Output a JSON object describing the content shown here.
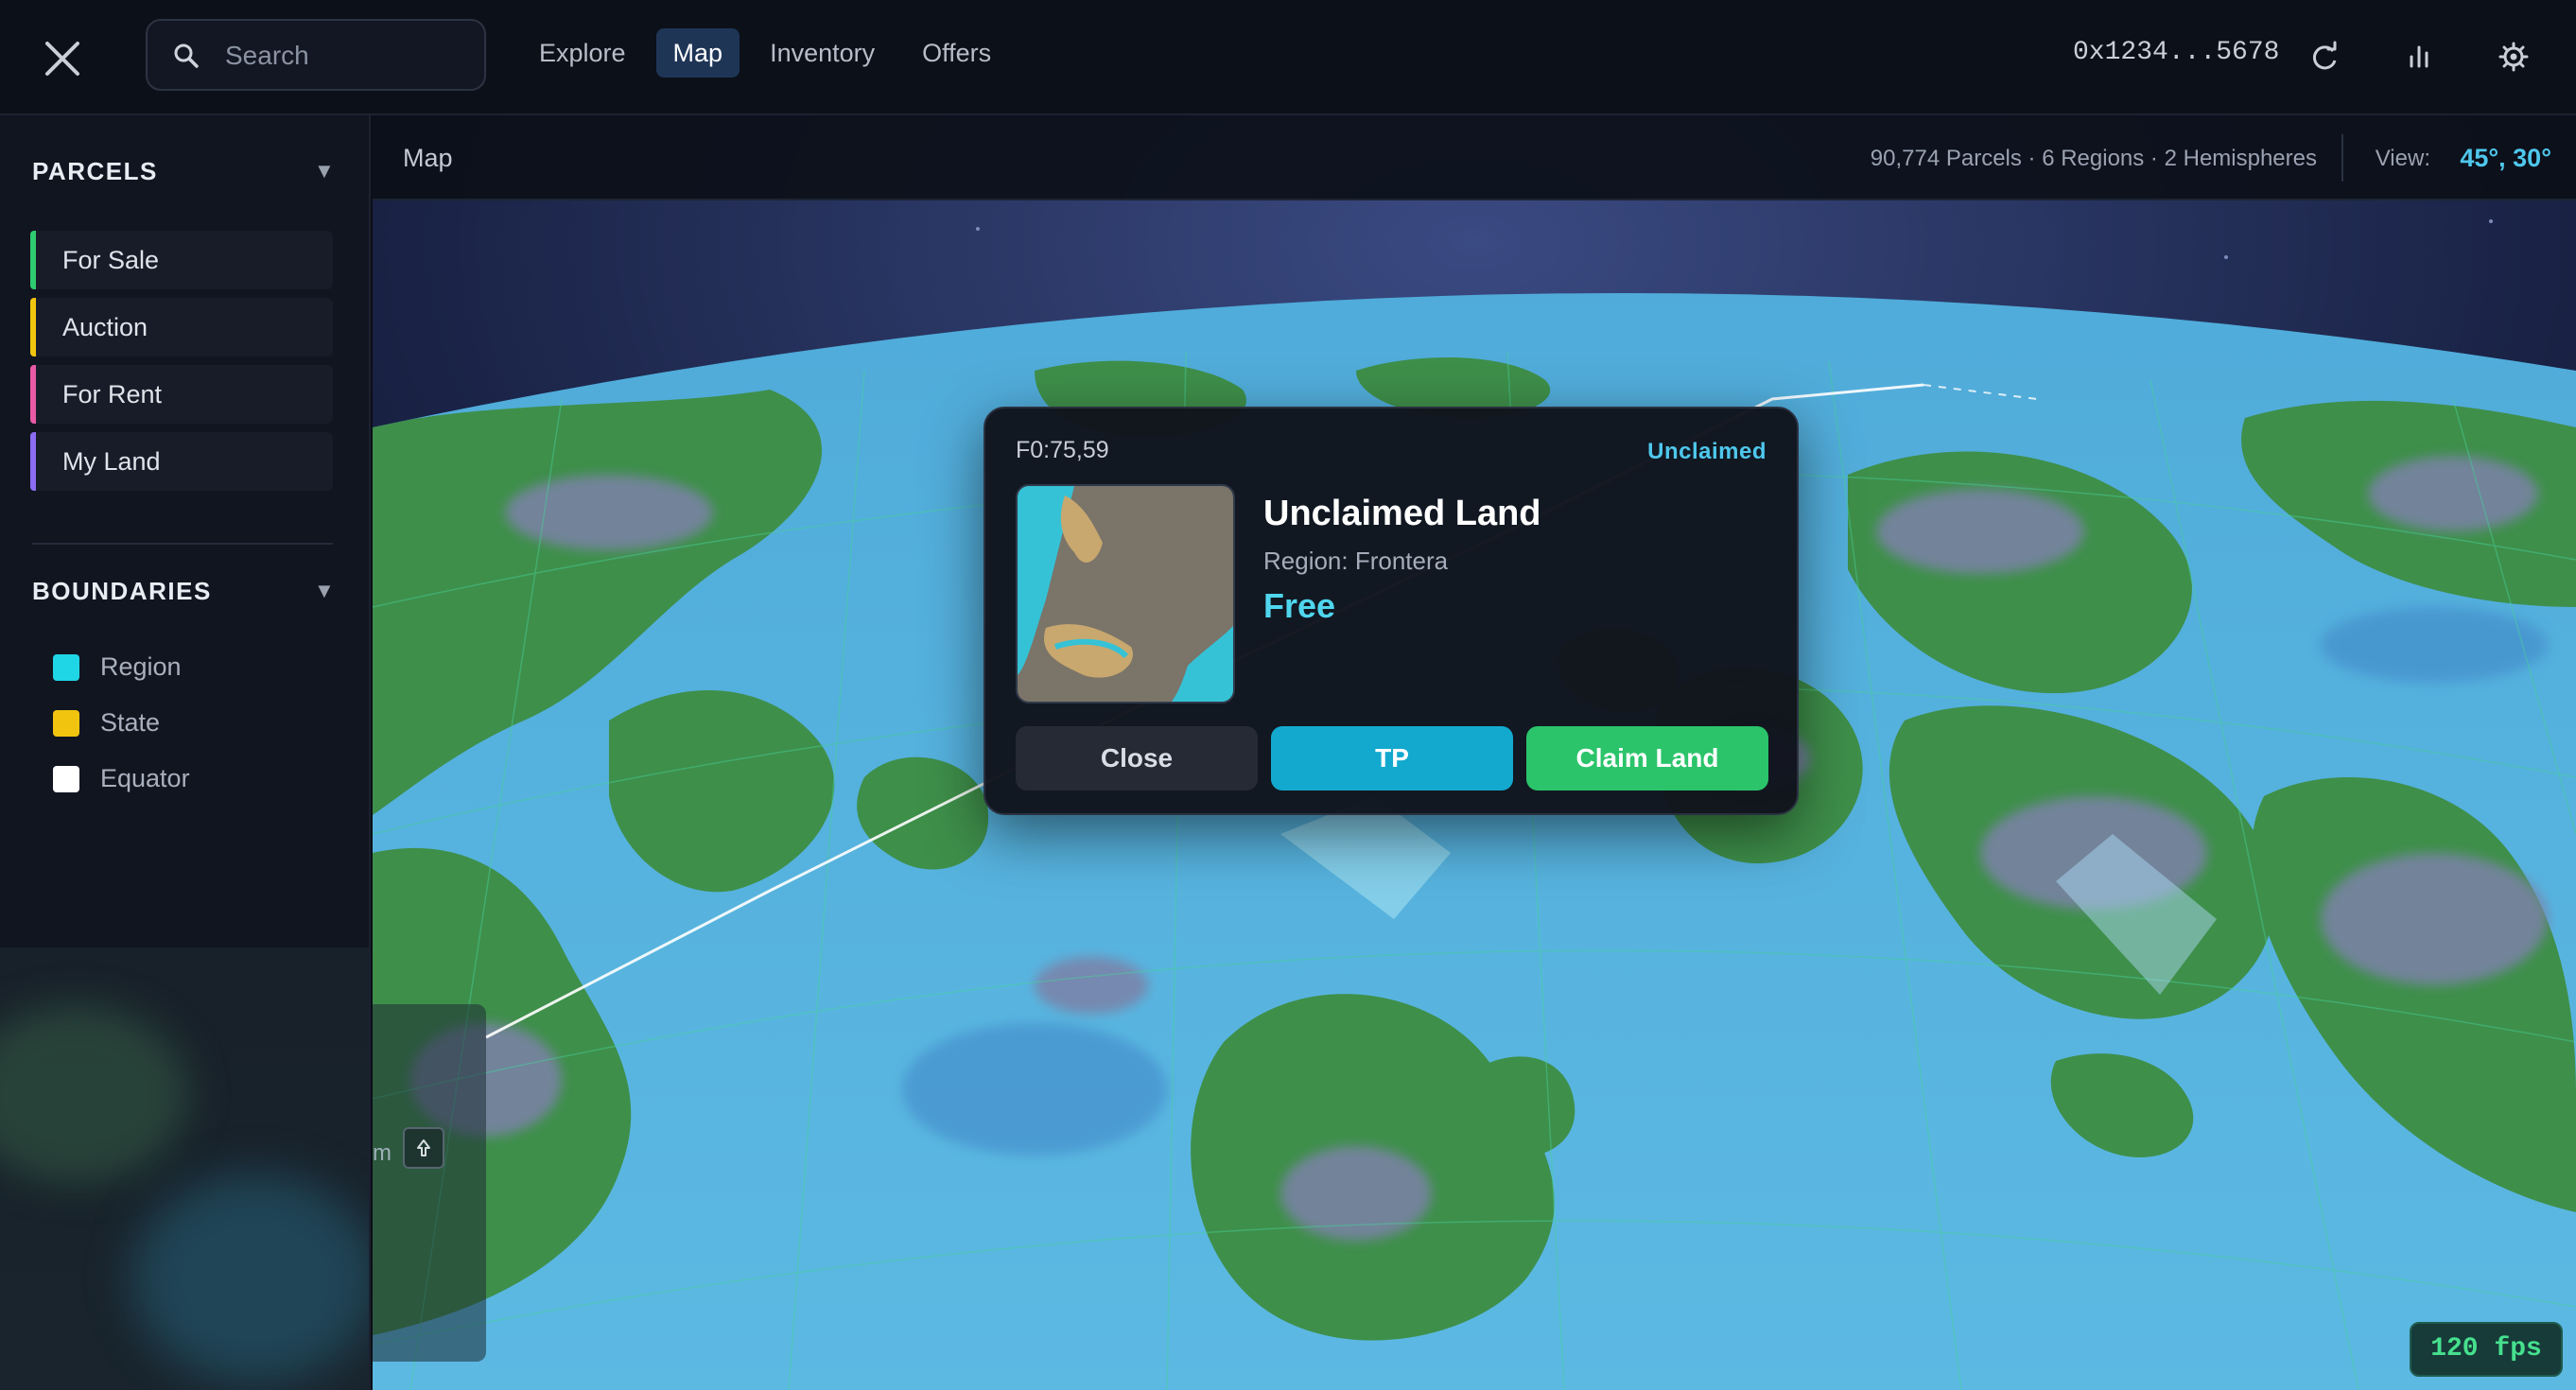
{
  "topbar": {
    "search_placeholder": "Search",
    "tabs": [
      {
        "label": "Explore",
        "active": false
      },
      {
        "label": "Map",
        "active": true
      },
      {
        "label": "Inventory",
        "active": false
      },
      {
        "label": "Offers",
        "active": false
      }
    ],
    "wallet": "0x1234...5678",
    "icons": [
      "close-icon",
      "search-icon",
      "refresh-icon",
      "stats-icon",
      "settings-icon"
    ]
  },
  "sidebar": {
    "parcels": {
      "title": "PARCELS",
      "items": [
        {
          "label": "For Sale",
          "color": "#2ecc71"
        },
        {
          "label": "Auction",
          "color": "#f1c40f"
        },
        {
          "label": "For Rent",
          "color": "#e85aa6"
        },
        {
          "label": "My Land",
          "color": "#8b6cf2"
        }
      ]
    },
    "boundaries": {
      "title": "BOUNDARIES",
      "items": [
        {
          "label": "Region",
          "color": "#1fd6e6"
        },
        {
          "label": "State",
          "color": "#f1c40f"
        },
        {
          "label": "Equator",
          "color": "#ffffff"
        }
      ]
    }
  },
  "map": {
    "title": "Map",
    "stats": "90,774 Parcels · 6 Regions · 2 Hemispheres",
    "view_label": "View:",
    "view_value": "45°, 30°",
    "mini_text": "m",
    "fps": "120 fps"
  },
  "popup": {
    "coord": "F0:75,59",
    "status": "Unclaimed",
    "title": "Unclaimed Land",
    "region": "Region: Frontera",
    "price": "Free",
    "buttons": {
      "close": "Close",
      "tp": "TP",
      "claim": "Claim Land"
    }
  },
  "colors": {
    "accent": "#4fc7ec",
    "ocean": "#4fb3dd",
    "land": "#3f8f4a",
    "claim": "#2bc46a",
    "tp": "#13a9cf"
  }
}
